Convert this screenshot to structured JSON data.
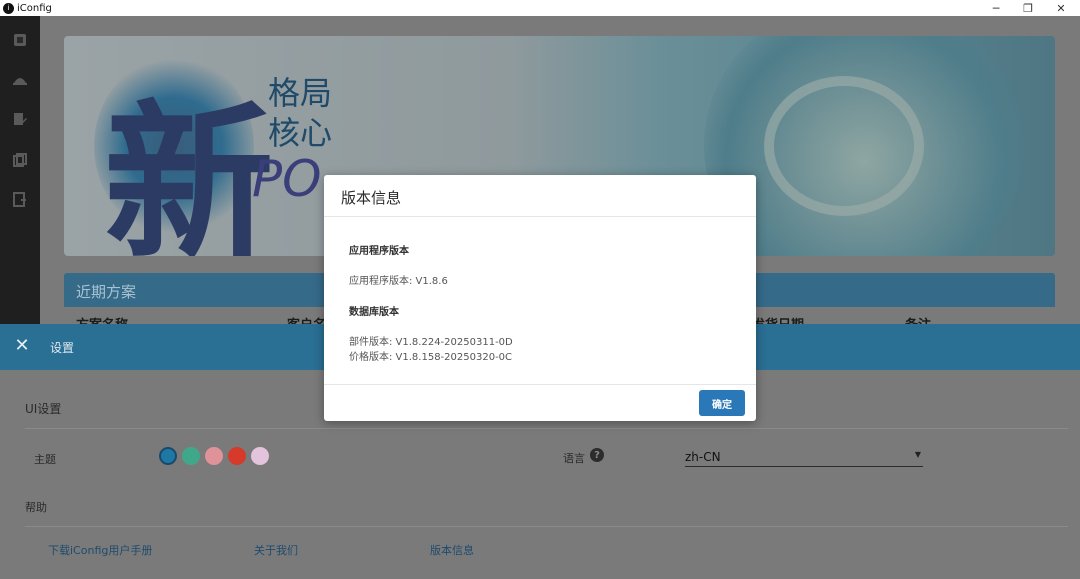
{
  "window": {
    "app_name": "iConfig",
    "app_icon_letter": "i",
    "controls": {
      "minimize": "─",
      "restore": "❐",
      "close": "✕"
    }
  },
  "sidebar": {
    "icons": [
      "contract-icon",
      "hat-icon",
      "edit-document-icon",
      "copy-icon",
      "export-icon"
    ]
  },
  "banner": {
    "line1": "格局",
    "line2": "核心",
    "logo_text": "PO",
    "brush_mark": "新"
  },
  "recent": {
    "title": "近期方案",
    "columns": [
      "方案名称",
      "客户名",
      "发货日期",
      "备注"
    ]
  },
  "settings": {
    "title": "设置",
    "close_glyph": "✕",
    "ui_section": "UI设置",
    "theme_label": "主题",
    "theme_colors": [
      "#1f77a6",
      "#3fa88b",
      "#e09299",
      "#d63a2b",
      "#e4c3dd"
    ],
    "language_label": "语言",
    "language_help_glyph": "?",
    "language_value": "zh-CN",
    "help_section": "帮助",
    "links": [
      "下载iConfig用户手册",
      "关于我们",
      "版本信息"
    ]
  },
  "modal": {
    "title": "版本信息",
    "app_version_heading": "应用程序版本",
    "app_version_text": "应用程序版本: V1.8.6",
    "db_version_heading": "数据库版本",
    "part_version_text": "部件版本: V1.8.224-20250311-0D",
    "price_version_text": "价格版本: V1.8.158-20250320-0C",
    "ok_label": "确定"
  }
}
